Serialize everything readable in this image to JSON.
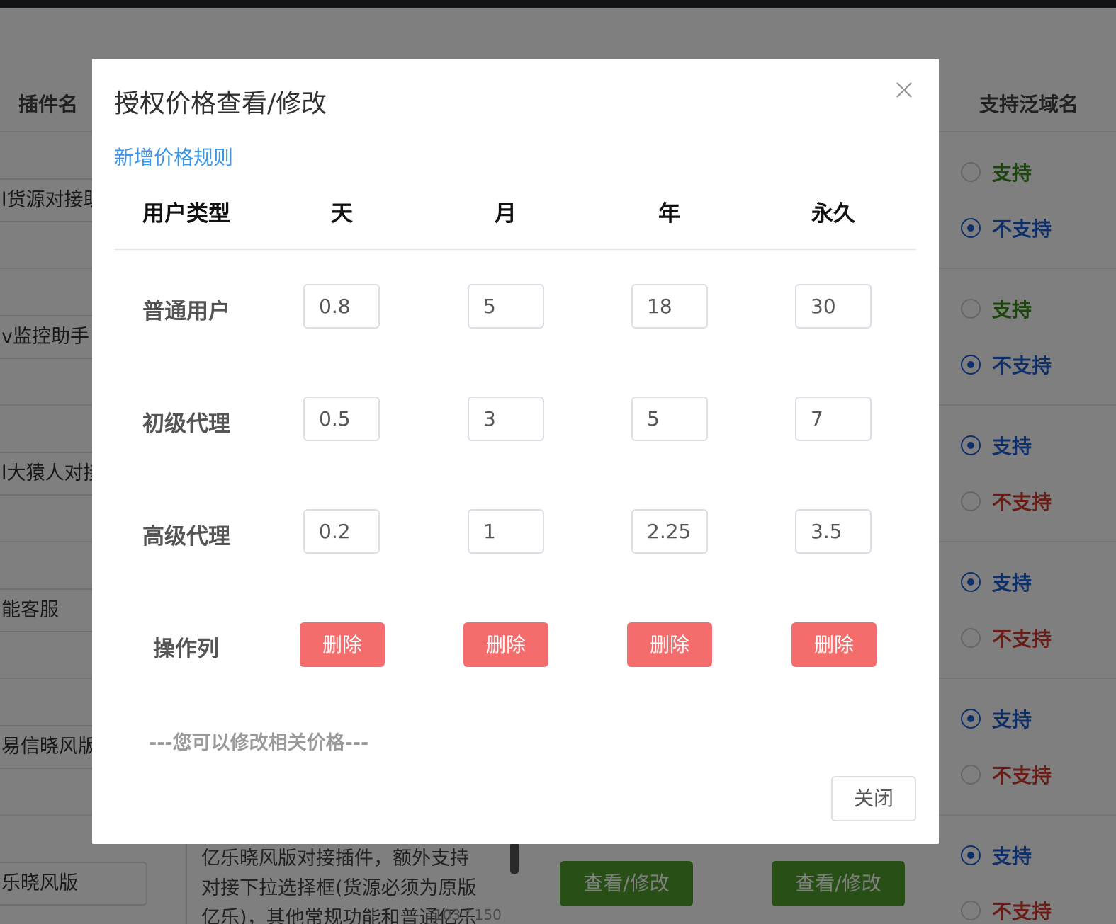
{
  "background": {
    "table_headers": {
      "plugin_name": "插件名",
      "wildcard_support": "支持泛域名"
    },
    "rows": [
      {
        "name": "l货源对接助",
        "support_label": "支持",
        "no_support_label": "不支持",
        "selected": "no"
      },
      {
        "name": "v监控助手",
        "support_label": "支持",
        "no_support_label": "不支持",
        "selected": "no"
      },
      {
        "name": "l大猿人对接",
        "support_label": "支持",
        "no_support_label": "不支持",
        "selected": "yes"
      },
      {
        "name": "能客服",
        "support_label": "支持",
        "no_support_label": "不支持",
        "selected": "yes"
      },
      {
        "name": "易信晓风版",
        "support_label": "支持",
        "no_support_label": "不支持",
        "selected": "yes"
      },
      {
        "name": "乐晓风版",
        "support_label": "支持",
        "no_support_label": "不支持",
        "selected": "yes"
      }
    ],
    "description_lines": [
      "亿乐晓风版对接插件，额外支持",
      "对接下拉选择框(货源必须为原版",
      "亿乐)，其他常规功能和普通亿乐"
    ],
    "description_counter": "103 / 150",
    "view_edit_label_1": "查看/修改",
    "view_edit_label_2": "查看/修改"
  },
  "dialog": {
    "title": "授权价格查看/修改",
    "add_rule_link": "新增价格规则",
    "columns": [
      "用户类型",
      "天",
      "月",
      "年",
      "永久"
    ],
    "rows": [
      {
        "label": "普通用户",
        "values": [
          "0.8",
          "5",
          "18",
          "30"
        ]
      },
      {
        "label": "初级代理",
        "values": [
          "0.5",
          "3",
          "5",
          "7"
        ]
      },
      {
        "label": "高级代理",
        "values": [
          "0.2",
          "1",
          "2.25",
          "3.5"
        ]
      }
    ],
    "action_row_label": "操作列",
    "delete_labels": [
      "删除",
      "删除",
      "删除",
      "删除"
    ],
    "hint": "---您可以修改相关价格---",
    "close_button": "关闭",
    "colors": {
      "link": "#3a95e8",
      "danger": "#f56c6c",
      "radio_selected": "#1e5fd6",
      "support_green": "#3a8d1f",
      "no_support_red": "#d43a2f",
      "action_green": "#4f9f2d"
    },
    "icons": {
      "close": "close-icon"
    }
  }
}
